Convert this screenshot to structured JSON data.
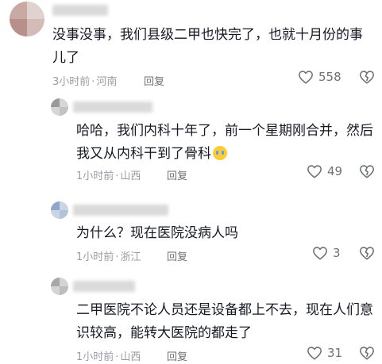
{
  "comments": [
    {
      "text": "没事没事，我们县级二甲也快完了，也就十月份的事儿了",
      "time": "3小时前",
      "location": "河南",
      "reply_label": "回复",
      "likes": "558"
    },
    {
      "text": "哈哈，我们内科十年了，前一个星期刚合并，然后我又从内科干到了骨科",
      "time": "1小时前",
      "location": "山西",
      "reply_label": "回复",
      "likes": "49"
    },
    {
      "text": "为什么？现在医院没病人吗",
      "time": "1小时前",
      "location": "浙江",
      "reply_label": "回复",
      "likes": "3"
    },
    {
      "text": "二甲医院不论人员还是设备都上不去，现在人们意识较高，能转大医院的都走了",
      "time": "1小时前",
      "location": "山西",
      "reply_label": "回复",
      "likes": "31"
    }
  ],
  "icons": {
    "like": "heart-outline-icon",
    "dislike": "broken-heart-icon",
    "emoji": "crying-face-icon"
  },
  "colors": {
    "text": "#161823",
    "meta": "#9a9ca3",
    "icon": "#6f7178"
  }
}
